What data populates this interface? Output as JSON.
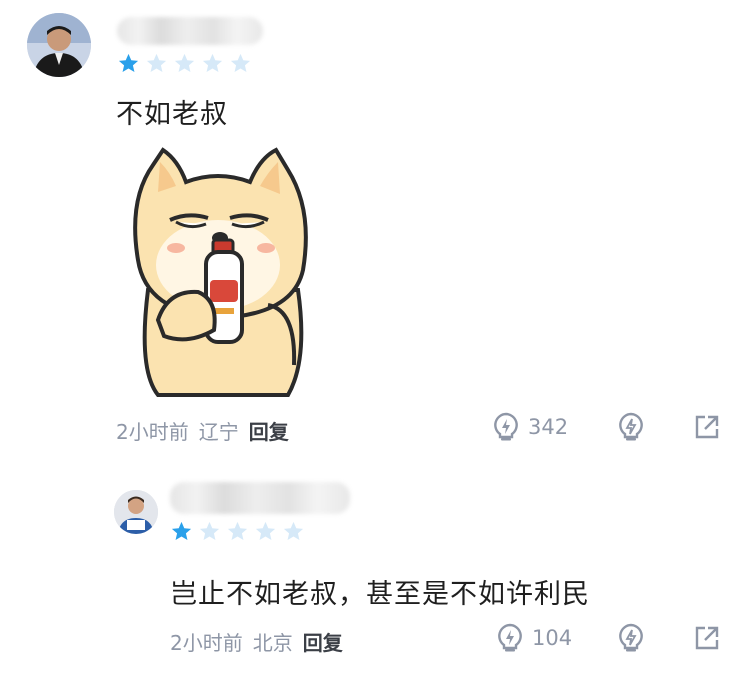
{
  "comments": [
    {
      "rating": 1,
      "text": "不如老叔",
      "time": "2小时前",
      "location": "辽宁",
      "reply_label": "回复",
      "likes": "342"
    },
    {
      "rating": 1,
      "text": "岂止不如老叔，甚至是不如许利民",
      "time": "2小时前",
      "location": "北京",
      "reply_label": "回复",
      "likes": "104"
    }
  ],
  "colors": {
    "star_filled": "#2aa0ea",
    "star_empty": "#d6e9f8",
    "meta_text": "#8e96a6"
  },
  "icons": [
    "lightbulb-like-icon",
    "lightbulb-dislike-icon",
    "share-external-icon"
  ]
}
